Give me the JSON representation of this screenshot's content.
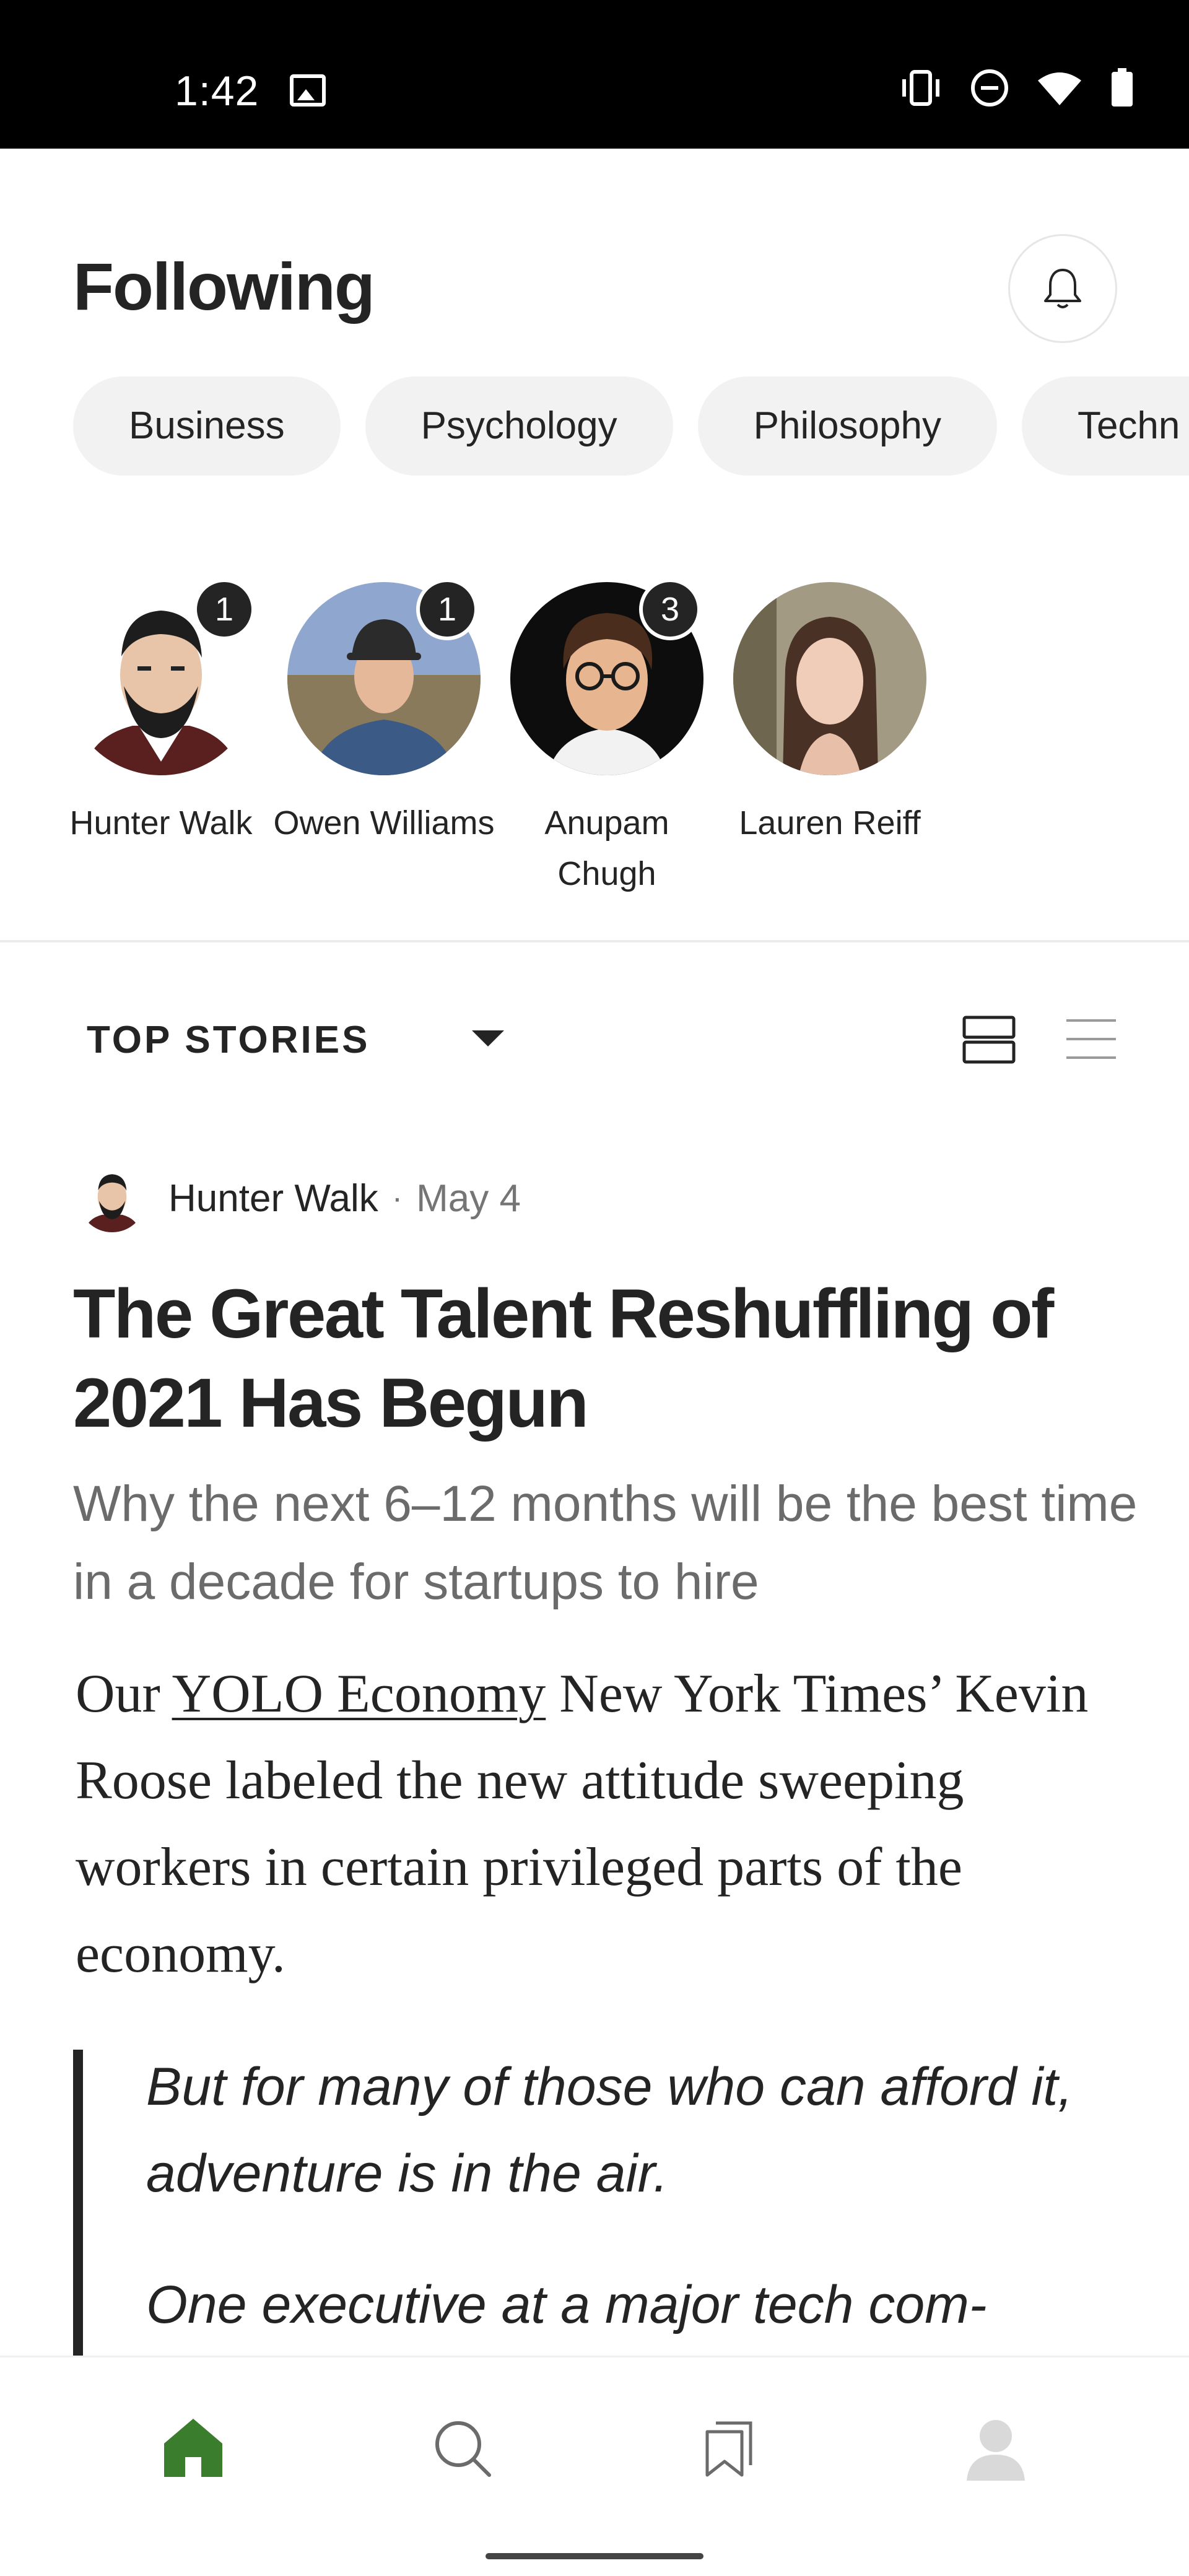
{
  "status_bar": {
    "time": "1:42",
    "icons": [
      "image-notification-icon",
      "vibrate-icon",
      "do-not-disturb-icon",
      "wifi-icon",
      "battery-icon"
    ]
  },
  "header": {
    "title": "Following",
    "notification_icon": "bell-icon"
  },
  "topics": [
    {
      "label": "Business"
    },
    {
      "label": "Psychology"
    },
    {
      "label": "Philosophy"
    },
    {
      "label": "Techn"
    }
  ],
  "following": [
    {
      "name": "Hunter Walk",
      "count": "1"
    },
    {
      "name": "Owen Williams",
      "count": "1"
    },
    {
      "name": "Anupam Chugh",
      "count": "3"
    },
    {
      "name": "Lauren Reiff",
      "count": ""
    }
  ],
  "feed": {
    "sort_label": "TOP STORIES",
    "view_icons": [
      "card-view-icon",
      "list-view-icon"
    ]
  },
  "article": {
    "author": "Hunter Walk",
    "separator": "·",
    "date": "May 4",
    "title": "The Great Talent Reshuffling of 2021 Has Begun",
    "subtitle": "Why the next 6–12 months will be the best time in a decade for startups to hire",
    "body_prefix": "Our ",
    "body_link": "YOLO Economy",
    "body_suffix": " New York Times’ Kevin Roose labeled the new attitude sweeping workers in certain privileged parts of the economy.",
    "quote_1": "But for many of those who can afford it, adventure is in the air.",
    "quote_2": "One executive at a major tech com-"
  },
  "bottom_nav": {
    "items": [
      "home-icon",
      "search-icon",
      "bookmarks-icon",
      "profile-icon"
    ],
    "active_color": "#3a7d2c"
  }
}
